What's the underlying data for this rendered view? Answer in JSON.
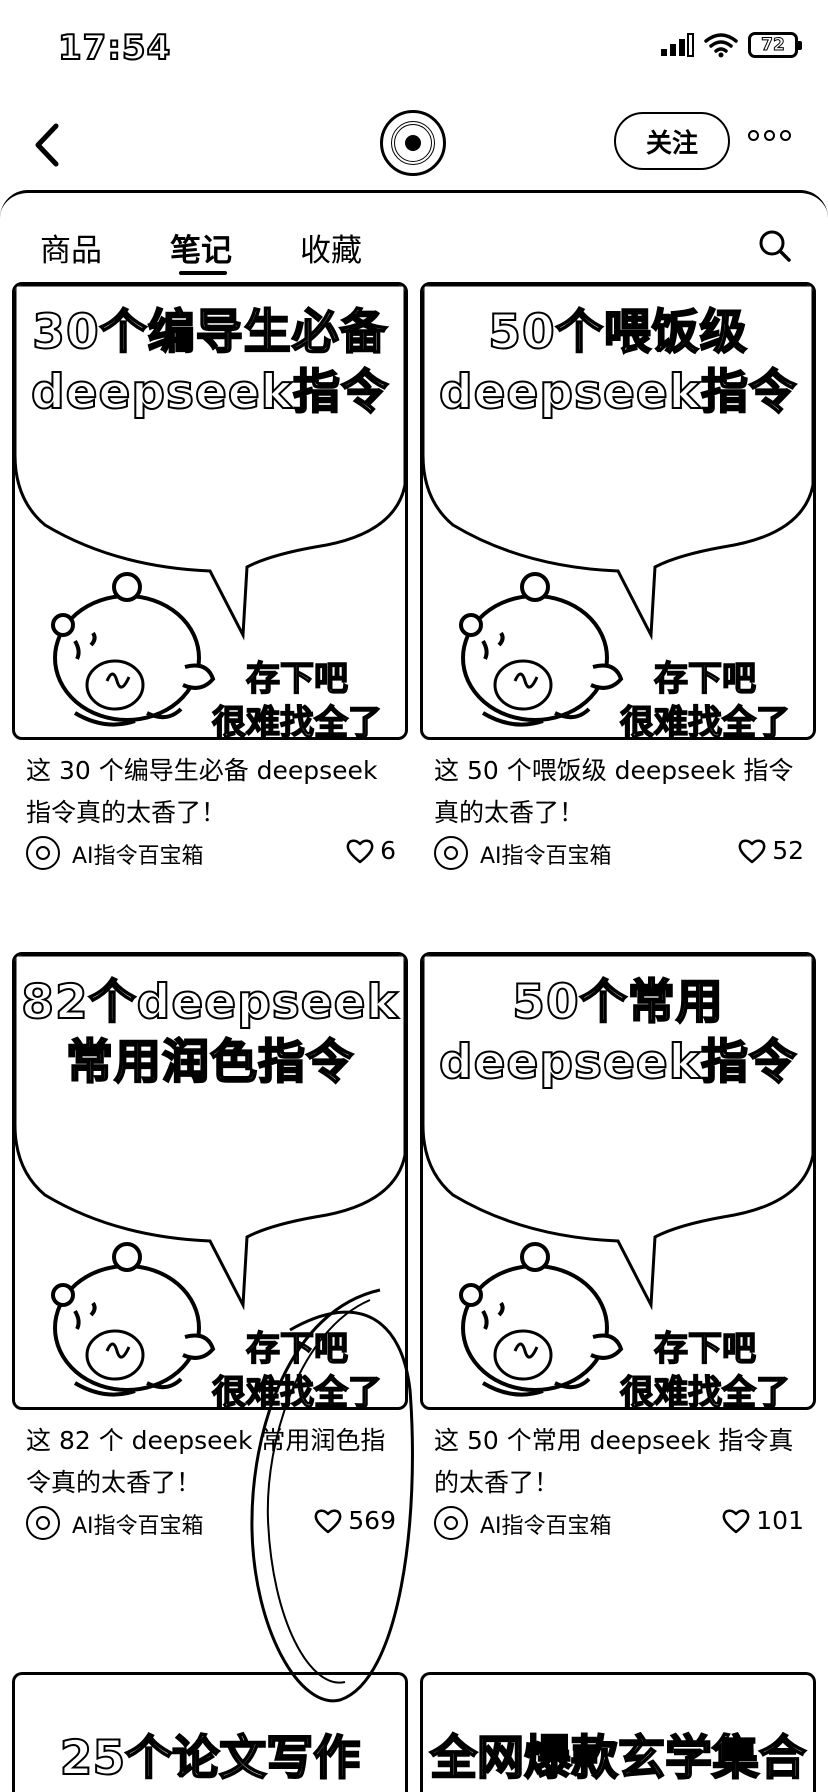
{
  "status_bar": {
    "time": "17:54",
    "battery": "72"
  },
  "header": {
    "follow_label": "关注"
  },
  "tabs": [
    {
      "label": "商品"
    },
    {
      "label": "笔记"
    },
    {
      "label": "收藏"
    }
  ],
  "active_tab": "笔记",
  "cards": [
    {
      "cover_title_line1": "30个编导生必备",
      "cover_title_line2": "deepseek指令",
      "cover_caption_line1": "存下吧",
      "cover_caption_line2": "很难找全了",
      "title": "这 30 个编导生必备 deepseek 指令真的太香了！",
      "author": "AI指令百宝箱",
      "likes": "6"
    },
    {
      "cover_title_line1": "50个喂饭级",
      "cover_title_line2": "deepseek指令",
      "cover_caption_line1": "存下吧",
      "cover_caption_line2": "很难找全了",
      "title": "这 50 个喂饭级 deepseek 指令真的太香了！",
      "author": "AI指令百宝箱",
      "likes": "52"
    },
    {
      "cover_title_line1": "82个deepseek",
      "cover_title_line2": "常用润色指令",
      "cover_caption_line1": "存下吧",
      "cover_caption_line2": "很难找全了",
      "title": "这 82 个 deepseek 常用润色指令真的太香了！",
      "author": "AI指令百宝箱",
      "likes": "569"
    },
    {
      "cover_title_line1": "50个常用",
      "cover_title_line2": "deepseek指令",
      "cover_caption_line1": "存下吧",
      "cover_caption_line2": "很难找全了",
      "title": "这 50 个常用 deepseek 指令真的太香了！",
      "author": "AI指令百宝箱",
      "likes": "101"
    }
  ],
  "partial_cards": [
    {
      "cover_title": "25个论文写作"
    },
    {
      "cover_title": "全网爆款玄学集合"
    }
  ],
  "icons": {
    "back": "chevron-left-icon",
    "more": "more-dots-icon",
    "search": "search-icon",
    "like": "heart-icon"
  }
}
